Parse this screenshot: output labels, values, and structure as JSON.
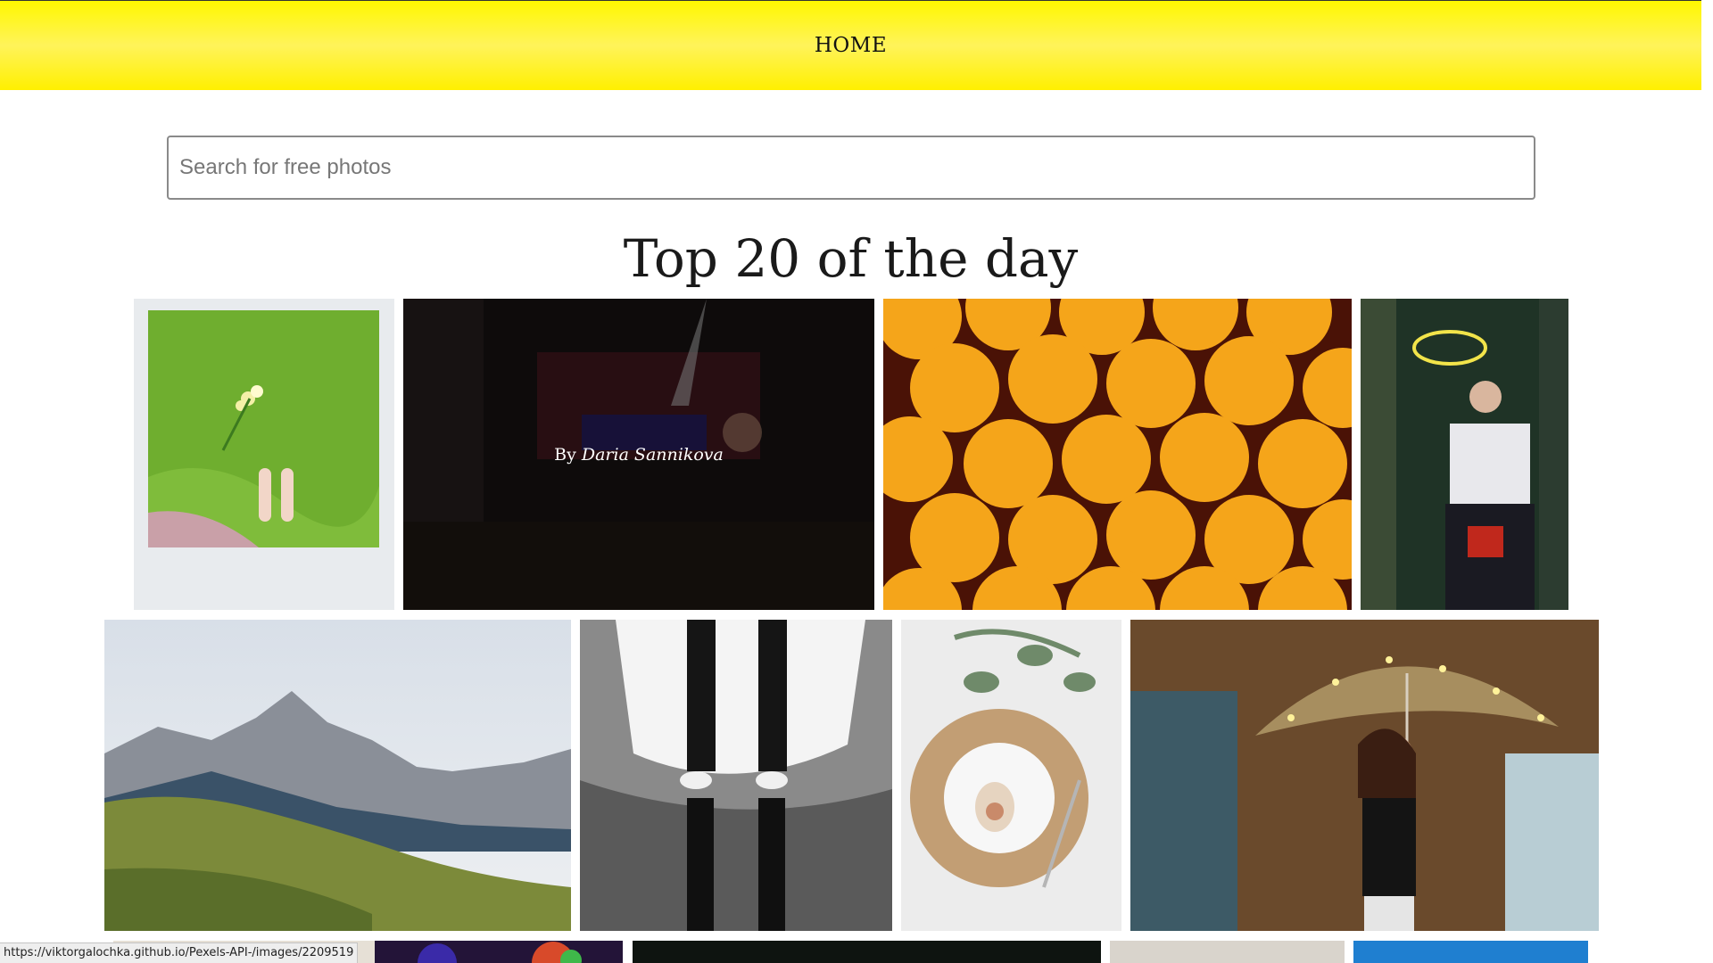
{
  "nav": {
    "home_label": "HOME"
  },
  "search": {
    "placeholder": "Search for free photos",
    "value": ""
  },
  "gallery": {
    "title": "Top 20 of the day",
    "hover_overlay": {
      "prefix": "By",
      "author": "Daria Sannikova"
    }
  },
  "status_bar": {
    "url": "https://viktorgalochka.github.io/Pexels-API-/images/2209519"
  },
  "colors": {
    "header_yellow": "#fff35a",
    "orange": "#f5a51a",
    "accent_text": "#1a1a1a"
  }
}
